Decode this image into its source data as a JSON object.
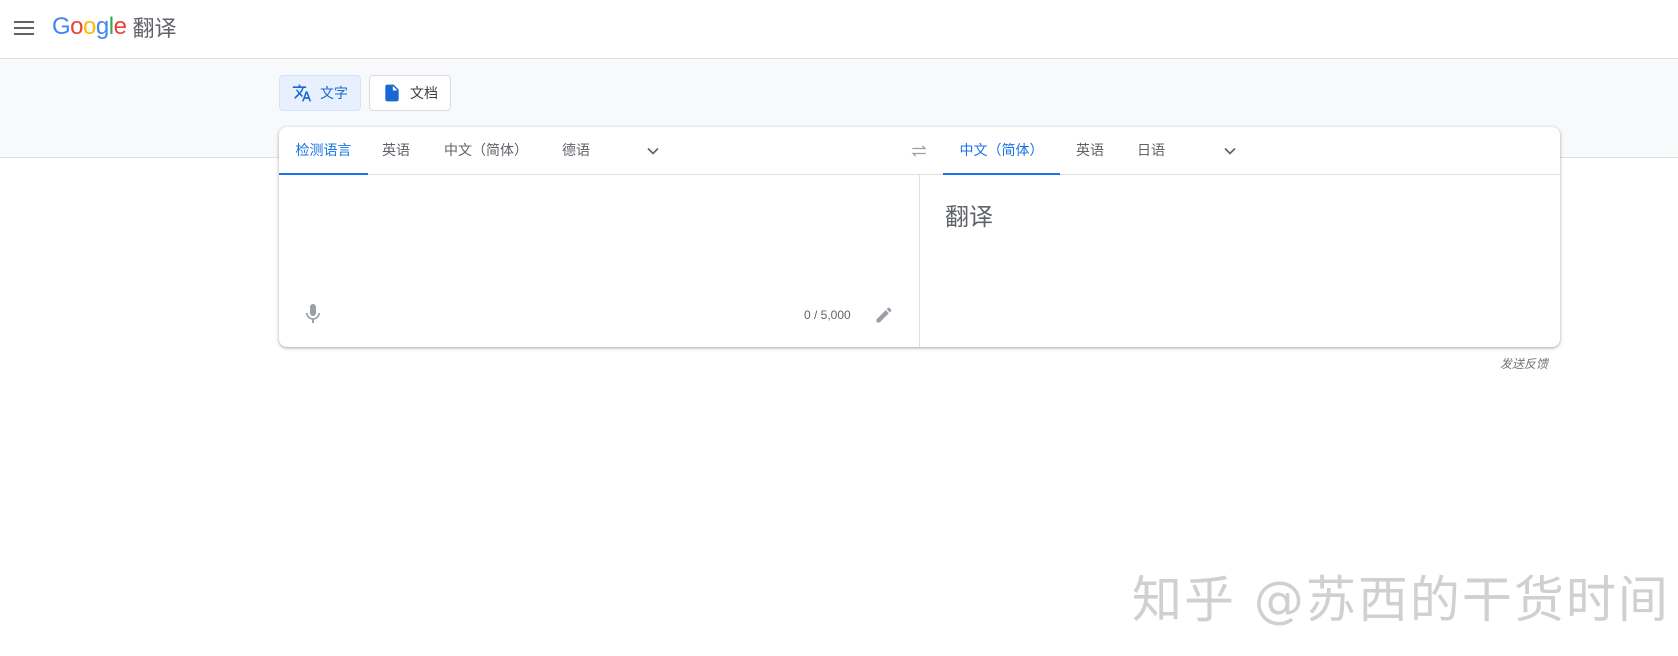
{
  "header": {
    "logo_letters": [
      "G",
      "o",
      "o",
      "g",
      "l",
      "e"
    ],
    "logo_colors": [
      "#4285F4",
      "#EA4335",
      "#FBBC05",
      "#4285F4",
      "#34A853",
      "#EA4335"
    ],
    "product_name": "翻译",
    "menu_icon": "hamburger-menu-icon"
  },
  "modes": [
    {
      "label": "文字",
      "icon": "translate-icon",
      "active": true
    },
    {
      "label": "文档",
      "icon": "document-icon",
      "active": false
    }
  ],
  "source_langs": [
    "检测语言",
    "英语",
    "中文（简体）",
    "德语"
  ],
  "target_langs": [
    "中文（简体）",
    "英语",
    "日语"
  ],
  "source": {
    "value": "",
    "char_count": "0 / 5,000"
  },
  "target": {
    "placeholder": "翻译"
  },
  "feedback": "发送反馈",
  "watermark": "知乎 @苏西的干货时间",
  "colors": {
    "accent": "#1a73e8",
    "active_mode_bg": "#e8f0fe",
    "band_bg": "#f8f9fa"
  }
}
